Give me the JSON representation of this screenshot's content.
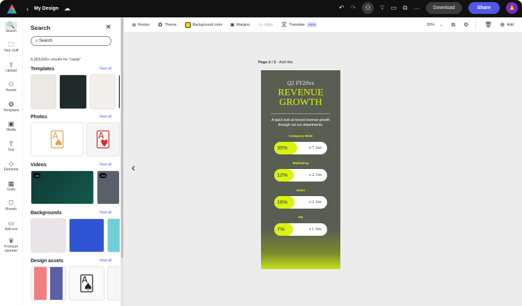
{
  "topbar": {
    "title": "My Design",
    "download": "Download",
    "share": "Share"
  },
  "rail": [
    {
      "icon": "search-icon",
      "label": "Search",
      "g": "🔍"
    },
    {
      "icon": "folder-icon",
      "label": "Your stuff",
      "g": "🗀"
    },
    {
      "icon": "upload-icon",
      "label": "Upload",
      "g": "⇪"
    },
    {
      "icon": "assets-icon",
      "label": "Assets",
      "g": "⚇"
    },
    {
      "icon": "templates-icon",
      "label": "Templates",
      "g": "❂"
    },
    {
      "icon": "media-icon",
      "label": "Media",
      "g": "▣"
    },
    {
      "icon": "text-icon",
      "label": "Text",
      "g": "T"
    },
    {
      "icon": "elements-icon",
      "label": "Elements",
      "g": "◇"
    },
    {
      "icon": "grids-icon",
      "label": "Grids",
      "g": "▦"
    },
    {
      "icon": "brands-icon",
      "label": "Brands",
      "g": "⛉"
    },
    {
      "icon": "addons-icon",
      "label": "Add-ons",
      "g": "▭"
    },
    {
      "icon": "crown-icon",
      "label": "Premium member",
      "g": "♛"
    }
  ],
  "panel": {
    "title": "Search",
    "search_placeholder": "Search",
    "results": "6,263,000+ results for \"cards\"",
    "view_all": "View all",
    "sections": [
      "Templates",
      "Photos",
      "Videos",
      "Backgrounds",
      "Design assets"
    ],
    "video_durations": [
      "14s",
      "19s"
    ]
  },
  "toolbar": {
    "resize": "Resize",
    "theme": "Theme",
    "bg": "Background color",
    "margins": "Margins",
    "align": "Align",
    "translate": "Translate",
    "new": "NEW",
    "zoom": "35%",
    "add": "Add"
  },
  "canvas": {
    "page_label": "Page 2 / 2",
    "add_title": "- Add title"
  },
  "design": {
    "subtitle": "Q2 FY20xx",
    "title1": "REVENUE",
    "title2": "GROWTH",
    "description": "A quick look at record revenue growth through out our departments.",
    "metrics": [
      {
        "label": "Company Wide",
        "percent": "35%",
        "value": 35,
        "amount": "+7.2m"
      },
      {
        "label": "Marketing",
        "percent": "12%",
        "value": 12,
        "amount": "+2.1m"
      },
      {
        "label": "Sales",
        "percent": "16%",
        "value": 16,
        "amount": "+3.2m"
      },
      {
        "label": "PR",
        "percent": "7%",
        "value": 7,
        "amount": "+1.4m"
      }
    ]
  },
  "colors": {
    "accent": "#5257e8",
    "lime": "#d9f20f",
    "page_bg": "#595e52"
  }
}
